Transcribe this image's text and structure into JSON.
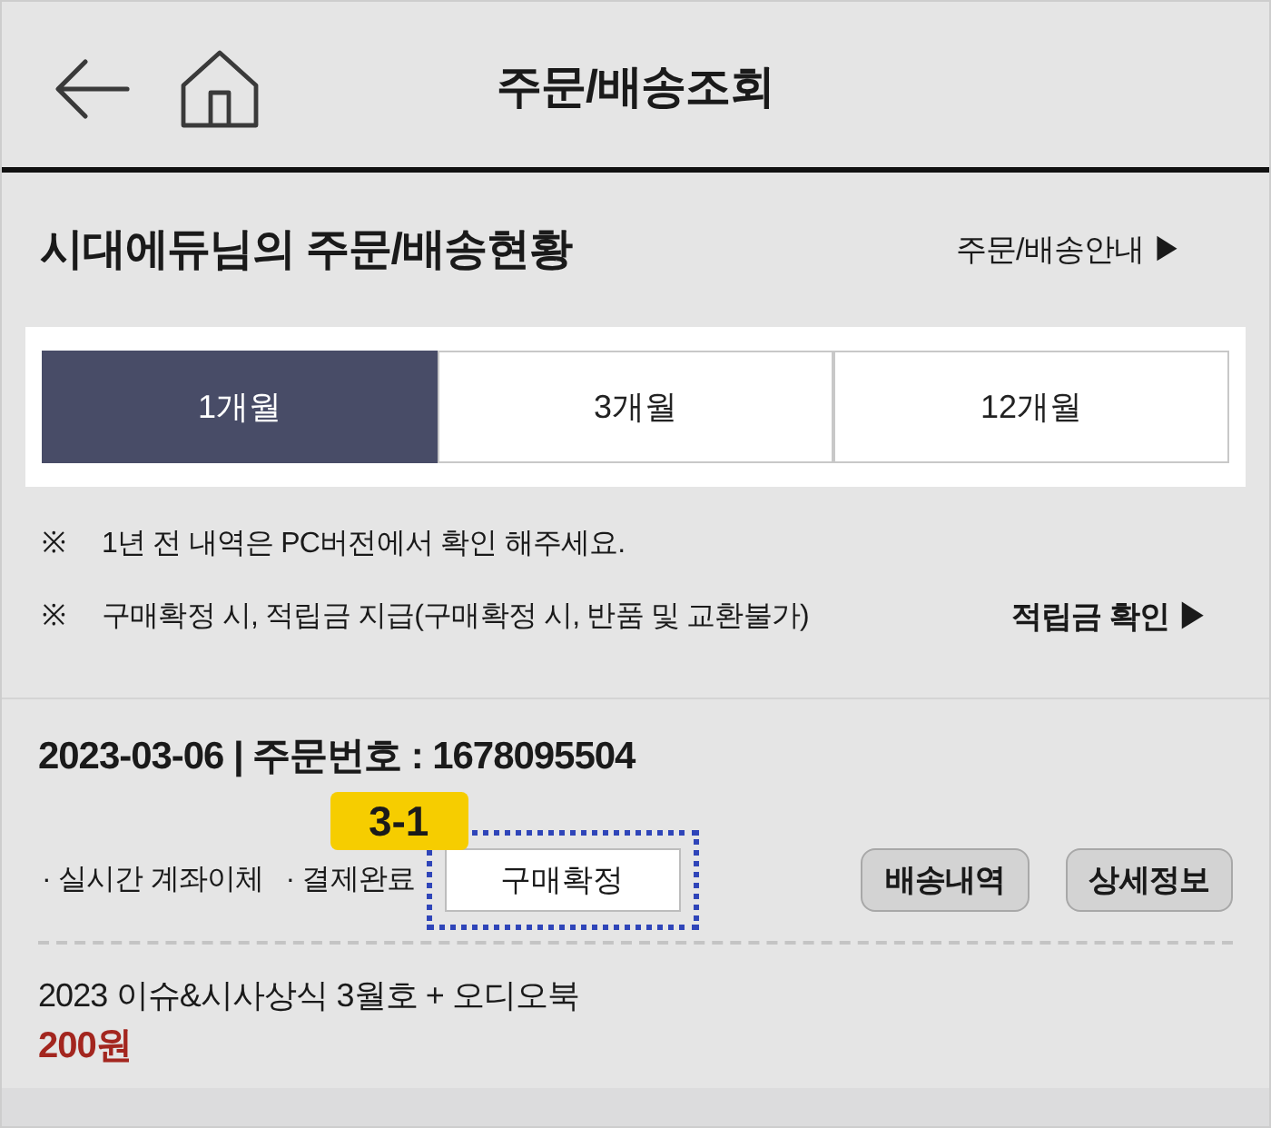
{
  "header": {
    "title": "주문/배송조회"
  },
  "summary": {
    "title": "시대에듀님의 주문/배송현황",
    "guide_link": "주문/배송안내 ▶"
  },
  "period_tabs": [
    {
      "label": "1개월",
      "selected": true
    },
    {
      "label": "3개월",
      "selected": false
    },
    {
      "label": "12개월",
      "selected": false
    }
  ],
  "notes": [
    {
      "mark": "※",
      "text": "1년 전 내역은 PC버전에서 확인 해주세요."
    },
    {
      "mark": "※",
      "text": "구매확정 시, 적립금 지급(구매확정 시, 반품 및 교환불가)"
    }
  ],
  "points_link": "적립금 확인 ▶",
  "order": {
    "heading": "2023-03-06 | 주문번호 : 1678095504",
    "details": [
      "· 실시간 계좌이체",
      "· 결제완료"
    ],
    "confirm_button": {
      "label": "구매확정",
      "highlighted": true,
      "callout": "3-1"
    },
    "buttons": [
      "배송내역",
      "상세정보"
    ],
    "items": [
      {
        "name": "2023 이슈&시사상식 3월호 + 오디오북",
        "price": "200원"
      }
    ]
  }
}
